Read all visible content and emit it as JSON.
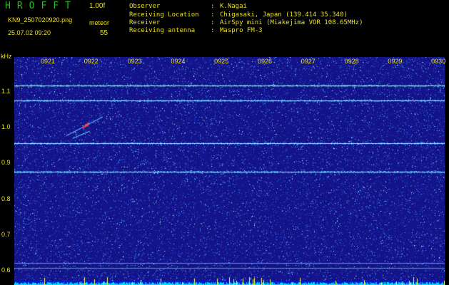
{
  "header": {
    "app_title": "HROFFT",
    "version": "1.00f",
    "filename": "KN9_2507020920.png",
    "meteor_label": "meteor",
    "timestamp": "25.07.02 09:20",
    "meteor_count": "55"
  },
  "metadata": [
    {
      "label": "Observer",
      "value": "K.Nagai"
    },
    {
      "label": "Receiving Location",
      "value": "Chigasaki, Japan (139.414 35.340)"
    },
    {
      "label": "Receiver",
      "value": "AirSpy mini (Miakejima VOR 108.65MHz)"
    },
    {
      "label": "Receiving antenna",
      "value": "Maspro FM-3"
    }
  ],
  "spectrogram": {
    "freq_unit": "kHz",
    "time_ticks": [
      "0921",
      "0922",
      "0923",
      "0924",
      "0925",
      "0926",
      "0927",
      "0928",
      "0929",
      "0930"
    ],
    "freq_ticks": [
      "1.1",
      "1.0",
      "0.9",
      "0.8",
      "0.7",
      "0.6"
    ],
    "carrier_lines_khz": [
      1.115,
      1.075,
      0.955,
      0.875,
      0.62,
      0.605
    ],
    "colors": {
      "background": "#14148a",
      "noise_speckle": "#3a8cff",
      "carrier": "#9fe8ff",
      "echo": "#ff3030",
      "baseline": "#00e0ff",
      "label": "#e8e020"
    }
  }
}
